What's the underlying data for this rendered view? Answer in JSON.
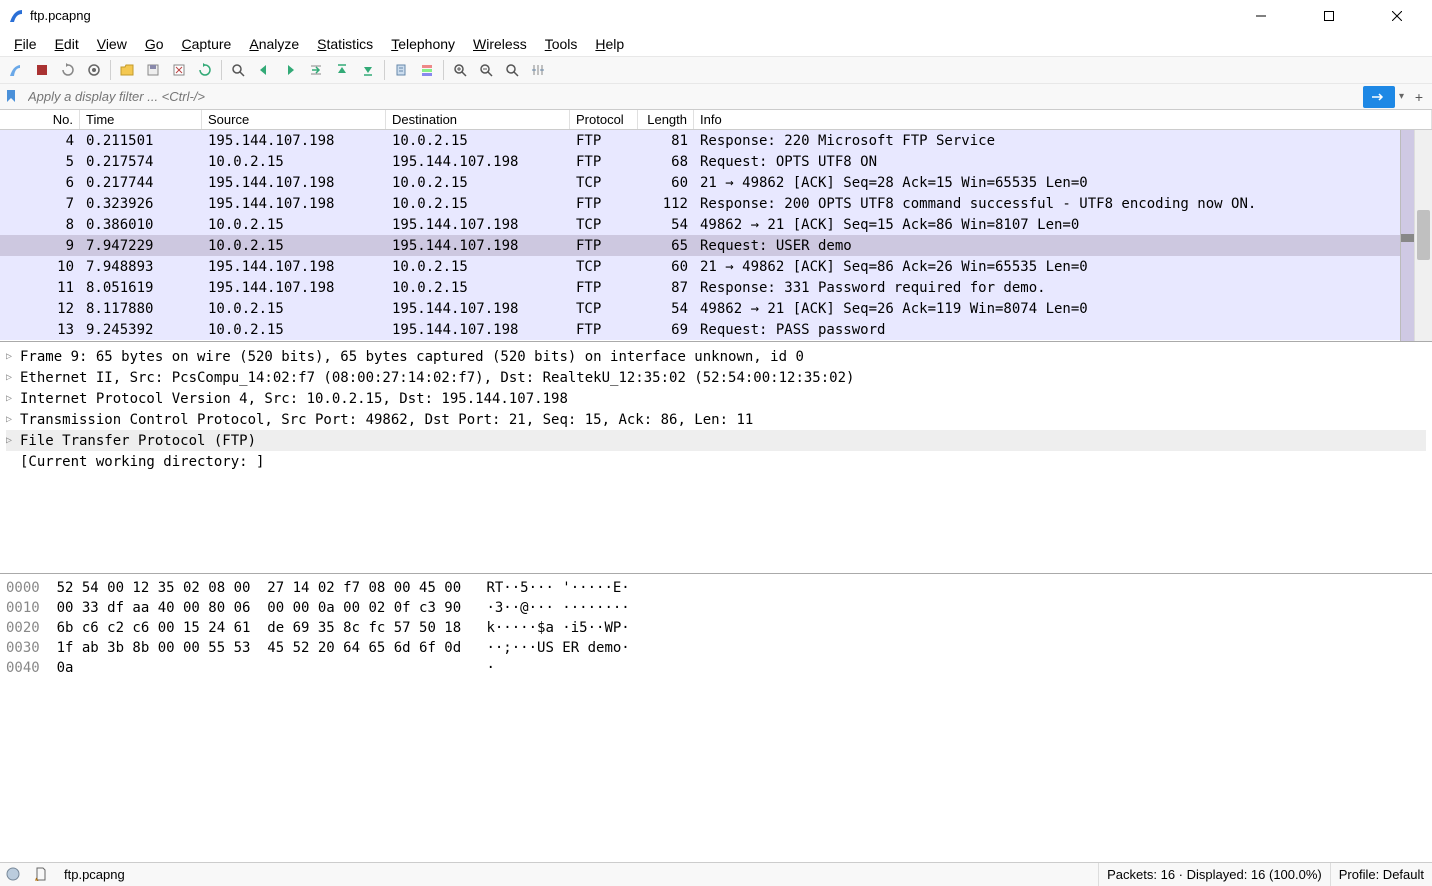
{
  "window": {
    "title": "ftp.pcapng"
  },
  "menu": [
    "File",
    "Edit",
    "View",
    "Go",
    "Capture",
    "Analyze",
    "Statistics",
    "Telephony",
    "Wireless",
    "Tools",
    "Help"
  ],
  "filter": {
    "placeholder": "Apply a display filter ... <Ctrl-/>"
  },
  "columns": {
    "no": "No.",
    "time": "Time",
    "src": "Source",
    "dst": "Destination",
    "proto": "Protocol",
    "len": "Length",
    "info": "Info"
  },
  "packets": [
    {
      "no": "4",
      "time": "0.211501",
      "src": "195.144.107.198",
      "dst": "10.0.2.15",
      "proto": "FTP",
      "len": "81",
      "info": "Response: 220 Microsoft FTP Service",
      "cls": "ftp"
    },
    {
      "no": "5",
      "time": "0.217574",
      "src": "10.0.2.15",
      "dst": "195.144.107.198",
      "proto": "FTP",
      "len": "68",
      "info": "Request: OPTS UTF8 ON",
      "cls": "ftp"
    },
    {
      "no": "6",
      "time": "0.217744",
      "src": "195.144.107.198",
      "dst": "10.0.2.15",
      "proto": "TCP",
      "len": "60",
      "info": "21 → 49862 [ACK] Seq=28 Ack=15 Win=65535 Len=0",
      "cls": "tcp"
    },
    {
      "no": "7",
      "time": "0.323926",
      "src": "195.144.107.198",
      "dst": "10.0.2.15",
      "proto": "FTP",
      "len": "112",
      "info": "Response: 200 OPTS UTF8 command successful - UTF8 encoding now ON.",
      "cls": "ftp"
    },
    {
      "no": "8",
      "time": "0.386010",
      "src": "10.0.2.15",
      "dst": "195.144.107.198",
      "proto": "TCP",
      "len": "54",
      "info": "49862 → 21 [ACK] Seq=15 Ack=86 Win=8107 Len=0",
      "cls": "tcp"
    },
    {
      "no": "9",
      "time": "7.947229",
      "src": "10.0.2.15",
      "dst": "195.144.107.198",
      "proto": "FTP",
      "len": "65",
      "info": "Request: USER demo",
      "cls": "ftp",
      "selected": true
    },
    {
      "no": "10",
      "time": "7.948893",
      "src": "195.144.107.198",
      "dst": "10.0.2.15",
      "proto": "TCP",
      "len": "60",
      "info": "21 → 49862 [ACK] Seq=86 Ack=26 Win=65535 Len=0",
      "cls": "tcp"
    },
    {
      "no": "11",
      "time": "8.051619",
      "src": "195.144.107.198",
      "dst": "10.0.2.15",
      "proto": "FTP",
      "len": "87",
      "info": "Response: 331 Password required for demo.",
      "cls": "ftp"
    },
    {
      "no": "12",
      "time": "8.117880",
      "src": "10.0.2.15",
      "dst": "195.144.107.198",
      "proto": "TCP",
      "len": "54",
      "info": "49862 → 21 [ACK] Seq=26 Ack=119 Win=8074 Len=0",
      "cls": "tcp"
    },
    {
      "no": "13",
      "time": "9.245392",
      "src": "10.0.2.15",
      "dst": "195.144.107.198",
      "proto": "FTP",
      "len": "69",
      "info": "Request: PASS password",
      "cls": "ftp"
    }
  ],
  "details": [
    {
      "text": "Frame 9: 65 bytes on wire (520 bits), 65 bytes captured (520 bits) on interface unknown, id 0",
      "exp": true
    },
    {
      "text": "Ethernet II, Src: PcsCompu_14:02:f7 (08:00:27:14:02:f7), Dst: RealtekU_12:35:02 (52:54:00:12:35:02)",
      "exp": true
    },
    {
      "text": "Internet Protocol Version 4, Src: 10.0.2.15, Dst: 195.144.107.198",
      "exp": true
    },
    {
      "text": "Transmission Control Protocol, Src Port: 49862, Dst Port: 21, Seq: 15, Ack: 86, Len: 11",
      "exp": true
    },
    {
      "text": "File Transfer Protocol (FTP)",
      "exp": true,
      "selected": true
    },
    {
      "text": "[Current working directory: ]",
      "exp": false
    }
  ],
  "hex": [
    {
      "off": "0000",
      "b": "52 54 00 12 35 02 08 00  27 14 02 f7 08 00 45 00",
      "a": "RT··5··· '·····E·"
    },
    {
      "off": "0010",
      "b": "00 33 df aa 40 00 80 06  00 00 0a 00 02 0f c3 90",
      "a": "·3··@··· ········"
    },
    {
      "off": "0020",
      "b": "6b c6 c2 c6 00 15 24 61  de 69 35 8c fc 57 50 18",
      "a": "k·····$a ·i5··WP·"
    },
    {
      "off": "0030",
      "b": "1f ab 3b 8b 00 00 55 53  45 52 20 64 65 6d 6f 0d",
      "a": "··;···US ER demo·"
    },
    {
      "off": "0040",
      "b": "0a",
      "a": "·"
    }
  ],
  "status": {
    "file": "ftp.pcapng",
    "packets": "Packets: 16 · Displayed: 16 (100.0%)",
    "profile": "Profile: Default"
  }
}
